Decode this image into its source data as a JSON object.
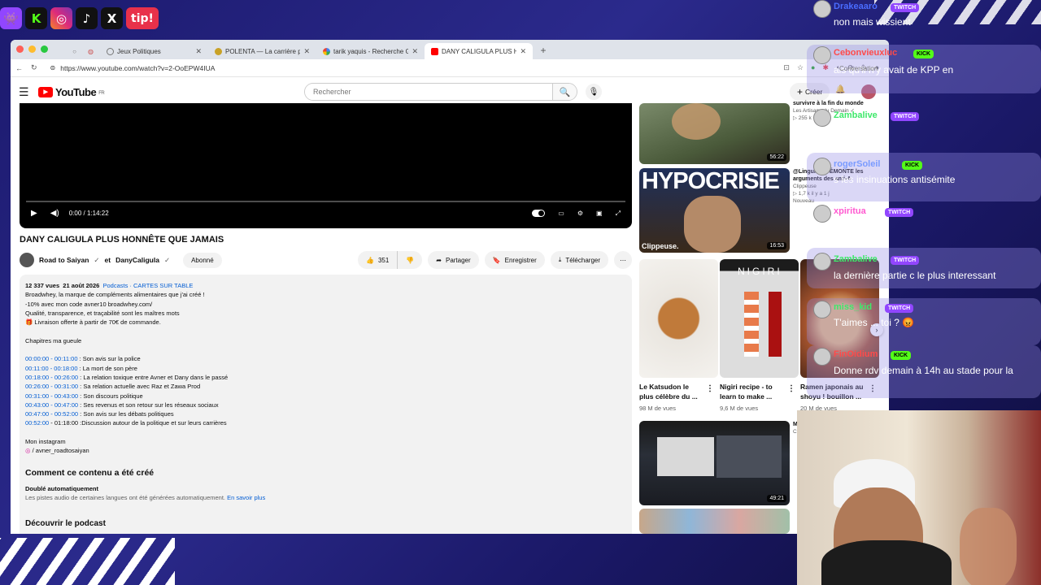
{
  "overlay": {
    "socials": [
      {
        "name": "twitch-icon",
        "glyph": "👾",
        "color": "#9146ff"
      },
      {
        "name": "kick-icon",
        "glyph": "K",
        "color": "#53fc18"
      },
      {
        "name": "instagram-icon",
        "glyph": "◎",
        "color": "#d6249f"
      },
      {
        "name": "tiktok-icon",
        "glyph": "♪",
        "color": "#111111"
      },
      {
        "name": "x-icon",
        "glyph": "𝕏",
        "color": "#111111"
      }
    ],
    "tip_label": "tip!"
  },
  "browser": {
    "tabs": [
      {
        "title": "Jeux Politiques",
        "active": false
      },
      {
        "title": "POLENTA — La carrière politique",
        "active": false
      },
      {
        "title": "tarik yaquis - Recherche Google",
        "active": false
      },
      {
        "title": "DANY CALIGULA PLUS HONNÊ",
        "active": true
      }
    ],
    "url": "https://www.youtube.com/watch?v=2-OoEPW4IUA"
  },
  "youtube": {
    "logo": "YouTube",
    "region": "FR",
    "search_placeholder": "Rechercher",
    "create_label": "Créer",
    "player": {
      "time": "0:00 / 1:14:22"
    },
    "video_title": "DANY CALIGULA PLUS HONNÊTE QUE JAMAIS",
    "channel": {
      "name1": "Road to Saiyan",
      "and": "et",
      "name2": "DanyCaligula",
      "subscribed": "Abonné"
    },
    "actions": {
      "likes": "351",
      "share": "Partager",
      "save": "Enregistrer",
      "download": "Télécharger"
    },
    "description": {
      "views": "12 337 vues",
      "date": "21 août 2026",
      "tags": "Podcasts · CARTES SUR TABLE",
      "lines": [
        "Broadwhey, la marque de compléments alimentaires que j'ai créé !",
        "-10% avec mon code avner10 broadwhey.com/",
        "Qualité, transparence, et traçabilité sont les maîtres mots",
        "🎁 Livraison offerte à partir de 70€ de commande."
      ],
      "chapters_title": "Chapitres ma gueule",
      "chapters": [
        {
          "time": "00:00:00 - 00:11:00",
          "text": " : Son avis sur la police"
        },
        {
          "time": "00:11:00 - 00:18:00",
          "text": " : La mort de son père"
        },
        {
          "time": "00:18:00 - 00:26:00",
          "text": " : La relation toxique entre Avner et Dany dans le passé"
        },
        {
          "time": "00:26:00 - 00:31:00",
          "text": " : Sa relation actuelle avec Raz et Zawa Prod"
        },
        {
          "time": "00:31:00 - 00:43:00",
          "text": " : Son discours politique"
        },
        {
          "time": "00:43:00 - 00:47:00",
          "text": " : Ses revenus et son retour sur les réseaux sociaux"
        },
        {
          "time": "00:47:00 - 00:52:00",
          "text": " : Son avis sur les débats politiques"
        },
        {
          "time": "00:52:00",
          "text": " - 01:18:00 :Discussion autour de la politique et sur leurs carrières"
        }
      ],
      "instagram_label": "Mon instagram",
      "instagram_handle": "/ avner_roadtosaiyan",
      "how_made_title": "Comment ce contenu a été créé",
      "dubbed_title": "Doublé automatiquement",
      "dubbed_text": "Les pistes audio de certaines langues ont été générées automatiquement.",
      "learn_more": "En savoir plus",
      "podcast_title": "Découvrir le podcast"
    },
    "sidebar": {
      "videos": [
        {
          "duration": "56:22",
          "title_partial": "survivre à la fin du monde",
          "channel": "Les Artisans du Demain ✓",
          "meta": "▷ 255 k"
        },
        {
          "duration": "16:53",
          "thumb_text": "HYPOCRISIE",
          "brand": "Clippeuse.",
          "title_partial": "@Linguiste DÉMONTE les arguments des anti-A",
          "channel": "Clippeuse",
          "meta": "▷ 1,7 k  il y a 1 j",
          "badge": "Nouveau"
        },
        {
          "duration": "49:21",
          "title_partial": "M",
          "meta": "C"
        }
      ],
      "shorts": [
        {
          "title": "Le Katsudon le plus célèbre du ...",
          "views": "98 M de vues"
        },
        {
          "title": "Nigiri recipe - to learn to make ...",
          "views": "9,6 M de vues",
          "thumb_text": "NIGIRI"
        },
        {
          "title": "Ramen japonais au shoyu ! bouillon ...",
          "views": "20 M de vues"
        }
      ]
    }
  },
  "chat": {
    "messages": [
      {
        "user": "Drakeaaro",
        "platform": "TWITCH",
        "text": "non mais wissient"
      },
      {
        "user": "Cebonvieuxluc",
        "platform": "KICK",
        "text": "ais qu'il n'y avait de KPP en"
      },
      {
        "user": "Zambalive",
        "platform": "TWITCH",
        "text": "?"
      },
      {
        "user": "rogerSoleil",
        "platform": "KICK",
        "text": "s les insinuations antisémite"
      },
      {
        "user": "xpiritua",
        "platform": "TWITCH",
        "text": ""
      },
      {
        "user": "Zambalive",
        "platform": "TWITCH",
        "text": "la dernière partie c le plus interessant"
      },
      {
        "user": "miss_kid",
        "platform": "TWITCH",
        "text": "T'aimes ... toi ? 😡"
      },
      {
        "user": "FinOidium",
        "platform": "KICK",
        "text": "Donne rdv demain à 14h au stade pour la"
      }
    ],
    "conversation_label": "Conversation"
  },
  "colors": {
    "twitch": "#9146ff",
    "kick": "#53fc18",
    "youtube_red": "#ff0000",
    "link_blue": "#065fd4"
  }
}
